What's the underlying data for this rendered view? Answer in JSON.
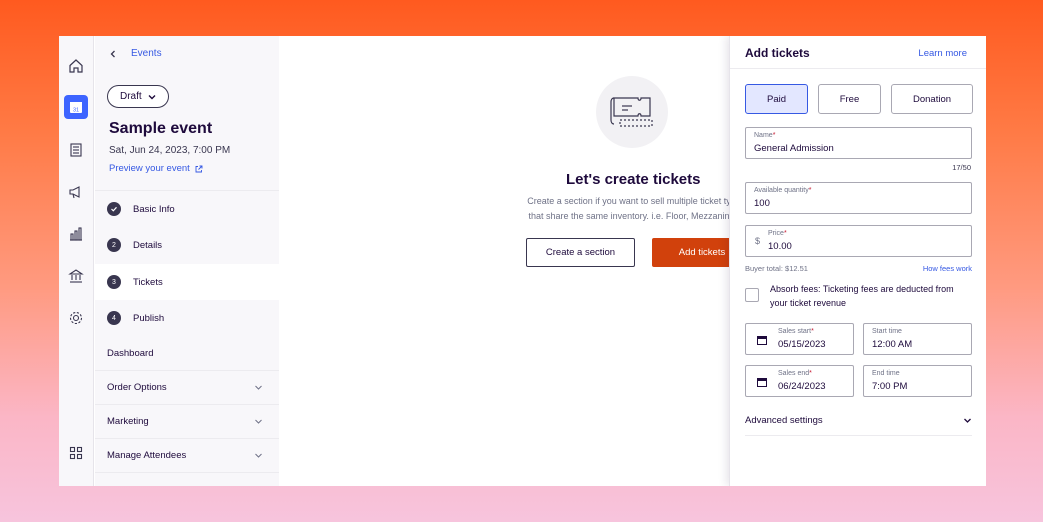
{
  "rail": {
    "icons": [
      "home-icon",
      "calendar-icon",
      "orders-icon",
      "megaphone-icon",
      "reports-icon",
      "finance-icon",
      "gear-icon",
      "apps-grid-icon"
    ],
    "calendar_day": "31"
  },
  "sidebar": {
    "back_label": "Events",
    "status": "Draft",
    "event_title": "Sample event",
    "event_date": "Sat, Jun 24, 2023, 7:00 PM",
    "preview_label": "Preview your event",
    "steps": [
      {
        "number": "",
        "label": "Basic Info",
        "done": true
      },
      {
        "number": "2",
        "label": "Details"
      },
      {
        "number": "3",
        "label": "Tickets",
        "active": true
      },
      {
        "number": "4",
        "label": "Publish"
      }
    ],
    "nav": [
      {
        "label": "Dashboard"
      },
      {
        "label": "Order Options"
      },
      {
        "label": "Marketing"
      },
      {
        "label": "Manage Attendees"
      }
    ]
  },
  "main": {
    "heading": "Let's create tickets",
    "desc_line1": "Create a section if you want to sell multiple ticket ty",
    "desc_line2": "that share the same inventory. i.e. Floor, Mezzanin",
    "create_section_label": "Create a section",
    "add_tickets_label": "Add tickets"
  },
  "panel": {
    "title": "Add tickets",
    "learn_more": "Learn more",
    "types": [
      "Paid",
      "Free",
      "Donation"
    ],
    "selected_type": "Paid",
    "name_label": "Name",
    "name_value": "General Admission",
    "name_counter": "17/50",
    "qty_label": "Available quantity",
    "qty_value": "100",
    "price_label": "Price",
    "currency": "$",
    "price_value": "10.00",
    "buyer_total": "Buyer total: $12.51",
    "fees_link": "How fees work",
    "absorb_text": "Absorb fees: Ticketing fees are deducted from your ticket revenue",
    "sales_start_label": "Sales start",
    "sales_start_value": "05/15/2023",
    "start_time_label": "Start time",
    "start_time_value": "12:00 AM",
    "sales_end_label": "Sales end",
    "sales_end_value": "06/24/2023",
    "end_time_label": "End time",
    "end_time_value": "7:00 PM",
    "advanced_label": "Advanced settings"
  },
  "colors": {
    "accent_blue": "#3659e3",
    "primary_orange": "#d1410c",
    "text_dark": "#1e0a3c"
  }
}
